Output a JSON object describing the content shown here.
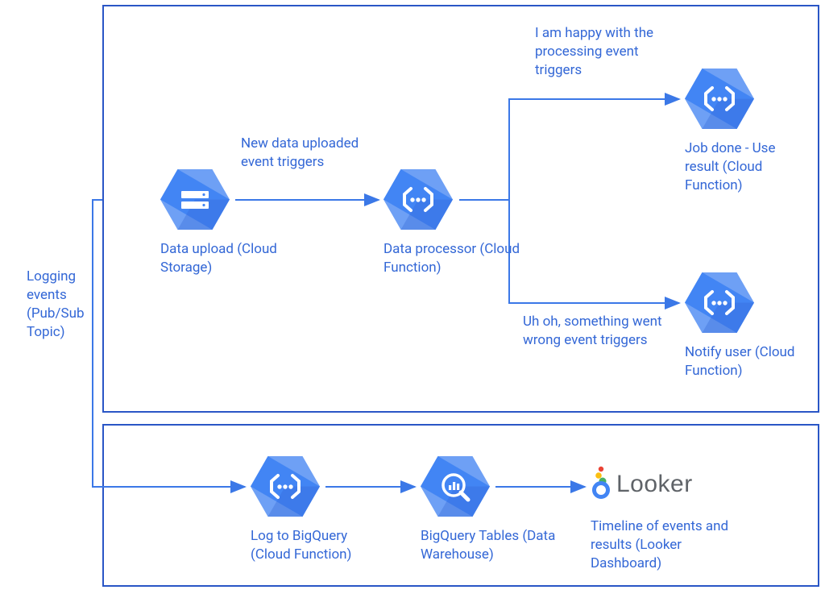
{
  "nodes": {
    "data_upload": {
      "label": "Data upload (Cloud Storage)"
    },
    "data_processor": {
      "label": "Data processor (Cloud Function)"
    },
    "job_done": {
      "label": "Job done - Use result (Cloud Function)"
    },
    "notify_user": {
      "label": "Notify user (Cloud Function)"
    },
    "log_bq": {
      "label": "Log to BigQuery (Cloud Function)"
    },
    "bq_tables": {
      "label": "BigQuery Tables (Data Warehouse)"
    },
    "looker": {
      "label": "Timeline of events and results (Looker Dashboard)",
      "brand": "Looker"
    }
  },
  "edges": {
    "upload_to_processor": "New data uploaded event triggers",
    "happy": "I am happy with the processing event triggers",
    "error": "Uh oh, something went wrong event triggers"
  },
  "left_label": "Logging events (Pub/Sub Topic)",
  "colors": {
    "stroke": "#3b78e7",
    "hex_light": "#6ea0f5",
    "hex_mid": "#4285f4",
    "hex_dark": "#3367d6"
  }
}
